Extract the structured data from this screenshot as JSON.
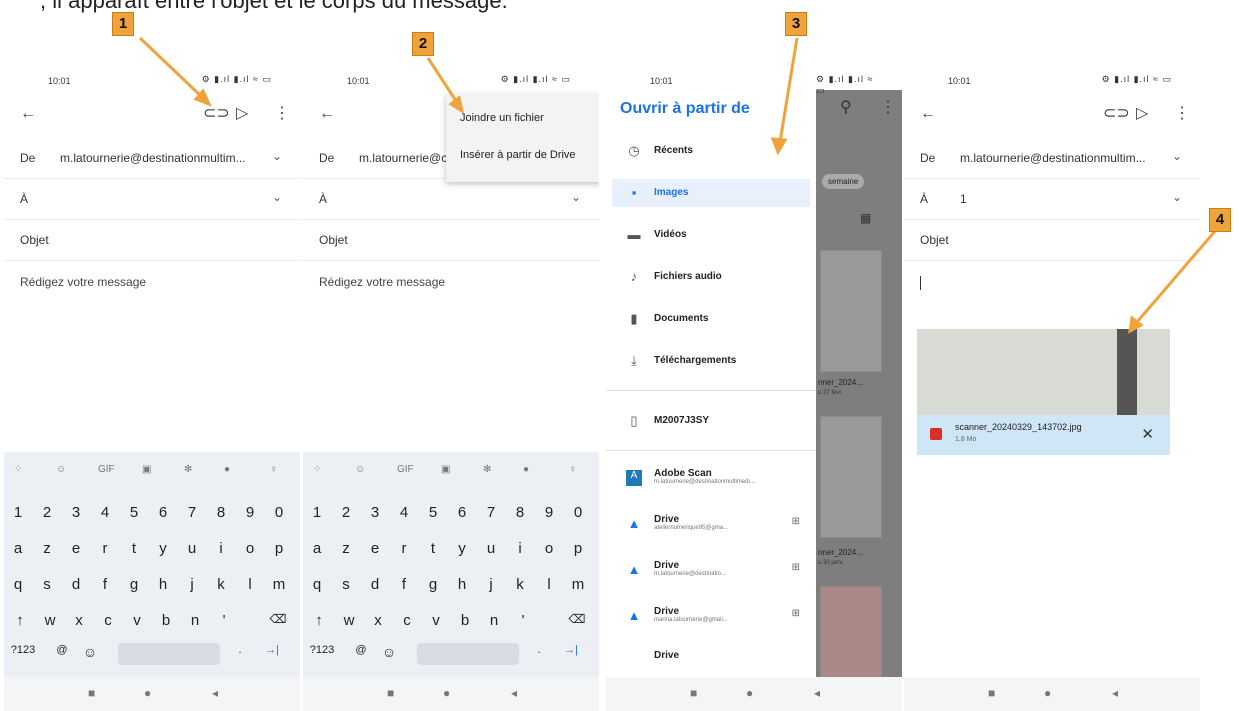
{
  "caption": ", il apparaît entre l'objet et le corps du message.",
  "status_time": "10:01",
  "compose": {
    "from_label": "De",
    "from_value": "m.latournerie@destinationmultim...",
    "from_value_cut": "m.latournerie@c",
    "to_label": "À",
    "to_value": "1",
    "subject_placeholder": "Objet",
    "body_placeholder": "Rédigez votre message"
  },
  "attach_menu": {
    "items": [
      "Joindre un fichier",
      "Insérer à partir de Drive"
    ]
  },
  "picker": {
    "title": "Ouvrir à partir de",
    "items": [
      {
        "icon": "clock-icon",
        "label": "Récents"
      },
      {
        "icon": "image-icon",
        "label": "Images"
      },
      {
        "icon": "video-icon",
        "label": "Vidéos"
      },
      {
        "icon": "audio-icon",
        "label": "Fichiers audio"
      },
      {
        "icon": "document-icon",
        "label": "Documents"
      },
      {
        "icon": "download-icon",
        "label": "Téléchargements"
      }
    ],
    "device": "M2007J3SY",
    "apps": [
      {
        "label": "Adobe Scan",
        "sub": "m.latournerie@destinationmultimedi..."
      },
      {
        "label": "Drive",
        "sub": "ateliernumerique95@gma..."
      },
      {
        "label": "Drive",
        "sub": "m.latournerie@destinatio..."
      },
      {
        "label": "Drive",
        "sub": "marina.latournerie@gmail..."
      },
      {
        "label": "Drive",
        "sub": ""
      }
    ],
    "behind": {
      "chip": "semaine",
      "file1": "nner_2024...",
      "file1_date": "u 27 févr.",
      "file2": "nner_2024...",
      "file2_date": "u 30 janv."
    }
  },
  "attachment": {
    "filename": "scanner_20240329_143702.jpg",
    "size": "1,8 Mo"
  },
  "keyboard": {
    "toolbar": [
      "GIF"
    ],
    "digits": [
      "1",
      "2",
      "3",
      "4",
      "5",
      "6",
      "7",
      "8",
      "9",
      "0"
    ],
    "row1": [
      "a",
      "z",
      "e",
      "r",
      "t",
      "y",
      "u",
      "i",
      "o",
      "p"
    ],
    "row2": [
      "q",
      "s",
      "d",
      "f",
      "g",
      "h",
      "j",
      "k",
      "l",
      "m"
    ],
    "row3": [
      "w",
      "x",
      "c",
      "v",
      "b",
      "n",
      "'"
    ],
    "sym": "?123",
    "at": "@",
    "dot": "."
  },
  "markers": [
    "1",
    "2",
    "3",
    "4"
  ],
  "colors": {
    "marker": "#f0a33a",
    "accent": "#1a73e8"
  }
}
